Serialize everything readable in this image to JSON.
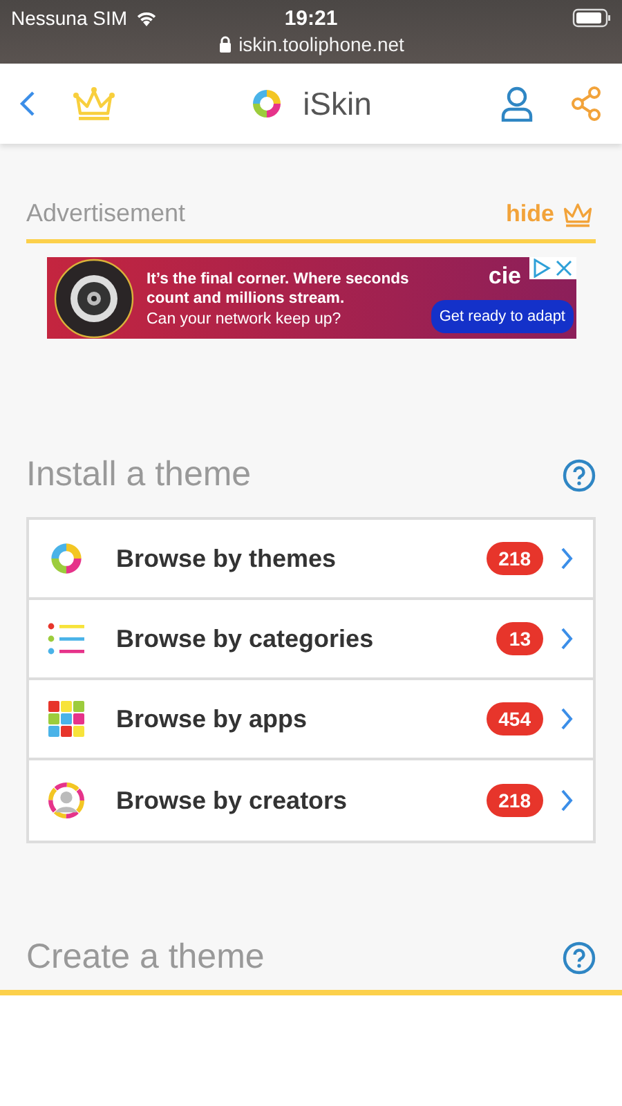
{
  "status_bar": {
    "carrier": "Nessuna SIM",
    "time": "19:21",
    "url": "iskin.tooliphone.net"
  },
  "header": {
    "title": "iSkin"
  },
  "advertisement": {
    "label": "Advertisement",
    "hide": "hide",
    "headline": "It’s the final corner. Where seconds count and millions stream.",
    "subline": "Can your network keep up?",
    "brand": "cie",
    "cta": "Get ready to adapt"
  },
  "install": {
    "title": "Install a theme",
    "items": [
      {
        "kind": "themes",
        "label": "Browse by themes",
        "count": "218"
      },
      {
        "kind": "categories",
        "label": "Browse by categories",
        "count": "13"
      },
      {
        "kind": "apps",
        "label": "Browse by apps",
        "count": "454"
      },
      {
        "kind": "creators",
        "label": "Browse by creators",
        "count": "218"
      }
    ]
  },
  "create": {
    "title": "Create a theme"
  }
}
